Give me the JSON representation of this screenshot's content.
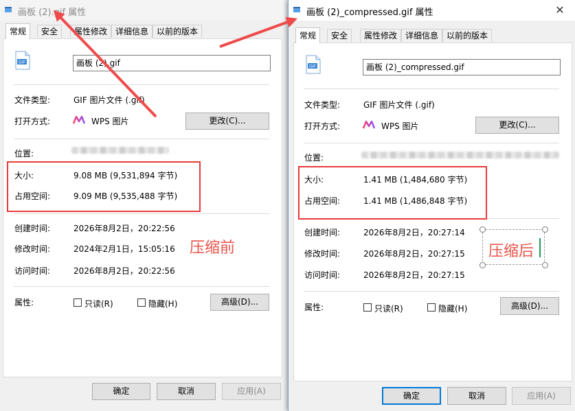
{
  "left": {
    "title": "画板 (2).gif 属性",
    "tabs": [
      "常规",
      "安全",
      "属性修改",
      "详细信息",
      "以前的版本"
    ],
    "filename": "画板 (2).gif",
    "labels": {
      "filetype": "文件类型:",
      "openwith": "打开方式:",
      "location": "位置:",
      "size": "大小:",
      "sizeondisk": "占用空间:",
      "created": "创建时间:",
      "modified": "修改时间:",
      "accessed": "访问时间:",
      "attributes": "属性:"
    },
    "filetype": "GIF 图片文件 (.gif)",
    "openwith_app": "WPS 图片",
    "change_btn": "更改(C)...",
    "size": "9.08 MB (9,531,894 字节)",
    "sizeondisk": "9.09 MB (9,535,488 字节)",
    "created": "2026年8月2日，20:22:56",
    "modified": "2024年2月1日，15:05:16",
    "accessed": "2026年8月2日，20:22:56",
    "readonly": "只读(R)",
    "hidden": "隐藏(H)",
    "advanced_btn": "高级(D)...",
    "ok_btn": "确定",
    "cancel_btn": "取消",
    "apply_btn": "应用(A)",
    "annotation": "压缩前"
  },
  "right": {
    "title": "画板 (2)_compressed.gif 属性",
    "tabs": [
      "常规",
      "安全",
      "属性修改",
      "详细信息",
      "以前的版本"
    ],
    "filename": "画板 (2)_compressed.gif",
    "labels": {
      "filetype": "文件类型:",
      "openwith": "打开方式:",
      "location": "位置:",
      "size": "大小:",
      "sizeondisk": "占用空间:",
      "created": "创建时间:",
      "modified": "修改时间:",
      "accessed": "访问时间:",
      "attributes": "属性:"
    },
    "filetype": "GIF 图片文件 (.gif)",
    "openwith_app": "WPS 图片",
    "change_btn": "更改(C)...",
    "size": "1.41 MB (1,484,680 字节)",
    "sizeondisk": "1.41 MB (1,486,848 字节)",
    "created": "2026年8月2日，20:27:14",
    "modified": "2026年8月2日，20:27:15",
    "accessed": "2026年8月2日，20:27:15",
    "readonly": "只读(R)",
    "hidden": "隐藏(H)",
    "advanced_btn": "高级(D)...",
    "ok_btn": "确定",
    "cancel_btn": "取消",
    "apply_btn": "应用(A)",
    "annotation": "压缩后"
  },
  "colors": {
    "annotation_red": "#e83a3a",
    "focus_blue": "#0078d7",
    "wps_gradient": [
      "#ff3b6b",
      "#8a4dff"
    ]
  },
  "icons": {
    "title_icon": "properties-icon",
    "file_icon": "gif-file-icon",
    "app_icon": "wps-picture-icon",
    "close": "close-icon"
  },
  "glyphs": {
    "close": "✕",
    "file_badge": "GIF"
  }
}
